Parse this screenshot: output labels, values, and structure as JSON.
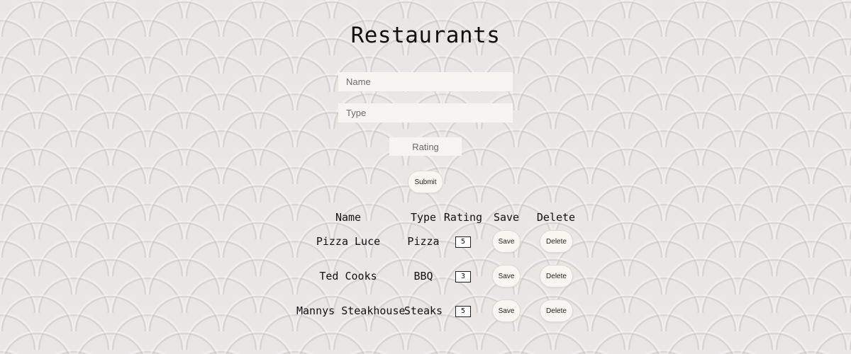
{
  "page": {
    "title": "Restaurants"
  },
  "form": {
    "name_placeholder": "Name",
    "type_placeholder": "Type",
    "rating_placeholder": "Rating",
    "submit_label": "Submit"
  },
  "table": {
    "headers": [
      "Name",
      "Type",
      "Rating",
      "Save",
      "Delete"
    ],
    "rows": [
      {
        "name": "Pizza Luce",
        "type": "Pizza",
        "rating": "5",
        "save": "Save",
        "delete": "Delete"
      },
      {
        "name": "Ted Cooks",
        "type": "BBQ",
        "rating": "3",
        "save": "Save",
        "delete": "Delete"
      },
      {
        "name": "Mannys Steakhouse",
        "type": "Steaks",
        "rating": "5",
        "save": "Save",
        "delete": "Delete"
      }
    ]
  },
  "colors": {
    "background": "#e9e6e6",
    "field_background": "#f6f5f1",
    "button_background": "#f7f6f1",
    "text": "#111111"
  }
}
